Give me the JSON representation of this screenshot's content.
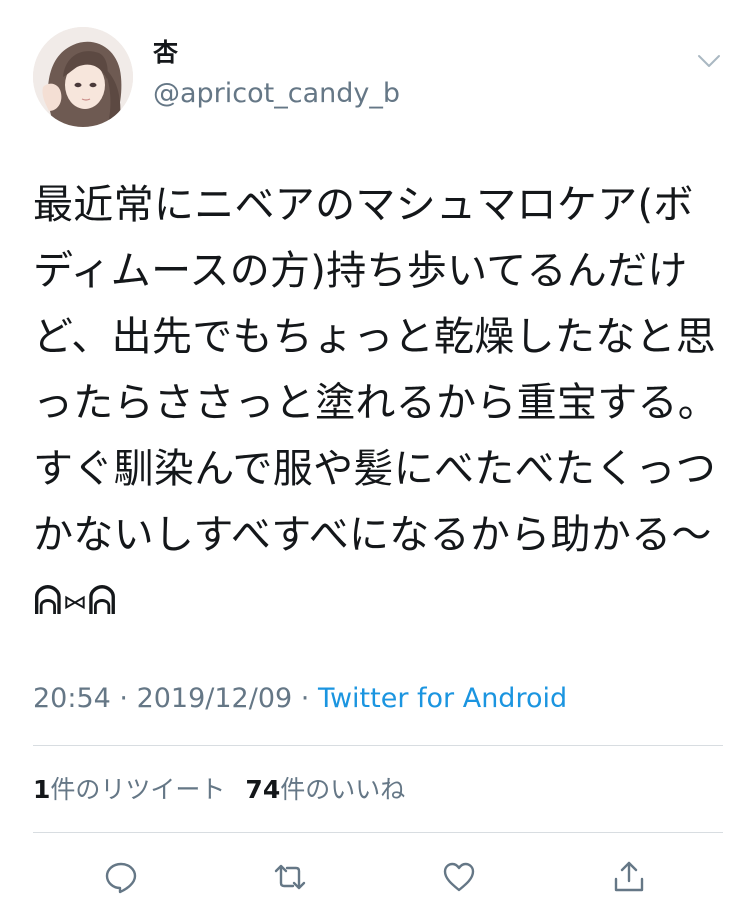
{
  "user": {
    "display_name": "杏",
    "handle": "@apricot_candy_b",
    "avatar_icon": "avatar-illustration"
  },
  "tweet": {
    "text": "最近常にニベアのマシュマロケア(ボディムースの方)持ち歩いてるんだけど、出先でもちょっと乾燥したなと思ったらささっと塗れるから重宝する。すぐ馴染んで服や髪にべたべたくっつかないしすべすべになるから助かる〜ᕱ⑅ᕱ",
    "time": "20:54",
    "separator": " · ",
    "date": "2019/12/09",
    "source": "Twitter for Android"
  },
  "stats": {
    "retweet_count": "1",
    "retweet_label": "件のリツイート",
    "like_count": "74",
    "like_label": "件のいいね"
  },
  "actions": [
    {
      "icon": "reply-icon"
    },
    {
      "icon": "retweet-icon"
    },
    {
      "icon": "like-icon"
    },
    {
      "icon": "share-icon"
    }
  ],
  "colors": {
    "text": "#14171a",
    "muted": "#657786",
    "link": "#1b95e0",
    "divider": "#d8dde1"
  }
}
